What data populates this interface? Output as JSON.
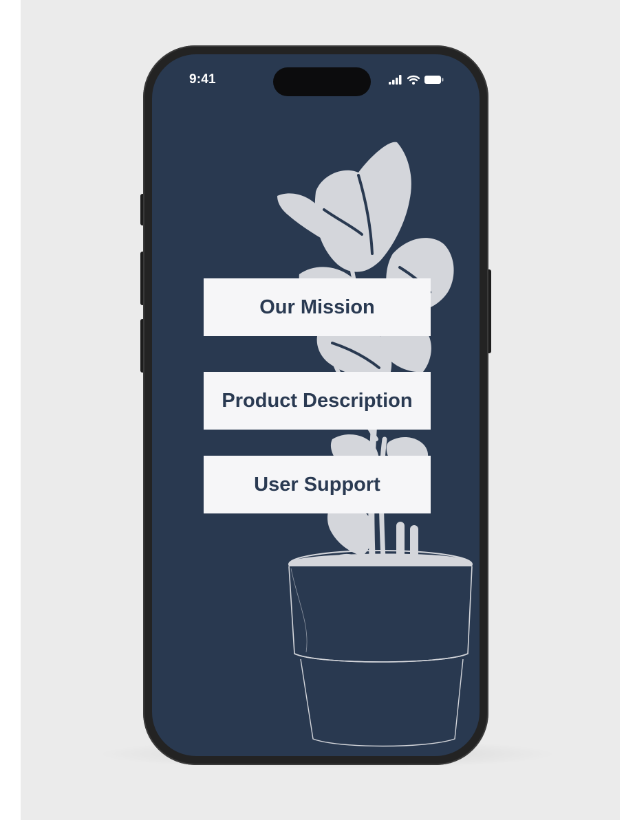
{
  "status_bar": {
    "time": "9:41",
    "icons": [
      "cellular-signal-icon",
      "wifi-icon",
      "battery-icon"
    ]
  },
  "menu": {
    "items": [
      {
        "label": "Our Mission"
      },
      {
        "label": "Product Description"
      },
      {
        "label": "User Support"
      }
    ]
  },
  "colors": {
    "screen_background": "#293950",
    "button_background": "#f6f6f8",
    "button_text": "#2a3a52",
    "plant_silhouette": "#d4d6db",
    "phone_frame": "#232323"
  }
}
